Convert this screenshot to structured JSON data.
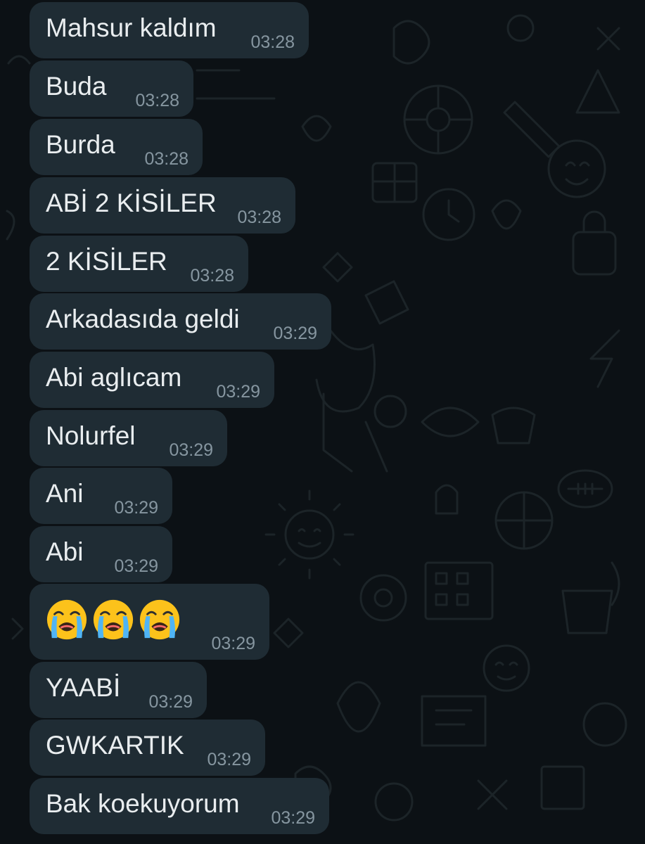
{
  "messages": [
    {
      "text": "Mahsur kaldım",
      "time": "03:28"
    },
    {
      "text": "Buda",
      "time": "03:28"
    },
    {
      "text": "Burda",
      "time": "03:28"
    },
    {
      "text": "ABİ 2 KİSİLER",
      "time": "03:28"
    },
    {
      "text": "2 KİSİLER",
      "time": "03:28"
    },
    {
      "text": "Arkadasıda geldi",
      "time": "03:29"
    },
    {
      "text": "Abi aglıcam",
      "time": "03:29"
    },
    {
      "text": "Nolurfel",
      "time": "03:29"
    },
    {
      "text": "Ani",
      "time": "03:29"
    },
    {
      "text": "Abi",
      "time": "03:29"
    },
    {
      "emoji": [
        "loudly-crying-face",
        "loudly-crying-face",
        "loudly-crying-face"
      ],
      "time": "03:29"
    },
    {
      "text": "YAABİ",
      "time": "03:29"
    },
    {
      "text": "GWKARTIK",
      "time": "03:29"
    },
    {
      "text": "Bak koekuyorum",
      "time": "03:29"
    }
  ],
  "colors": {
    "background": "#0c1115",
    "bubble": "#1f2c34",
    "message_text": "#e9edef",
    "timestamp": "#8696a0",
    "wallpaper_doodle": "#1c2428"
  }
}
